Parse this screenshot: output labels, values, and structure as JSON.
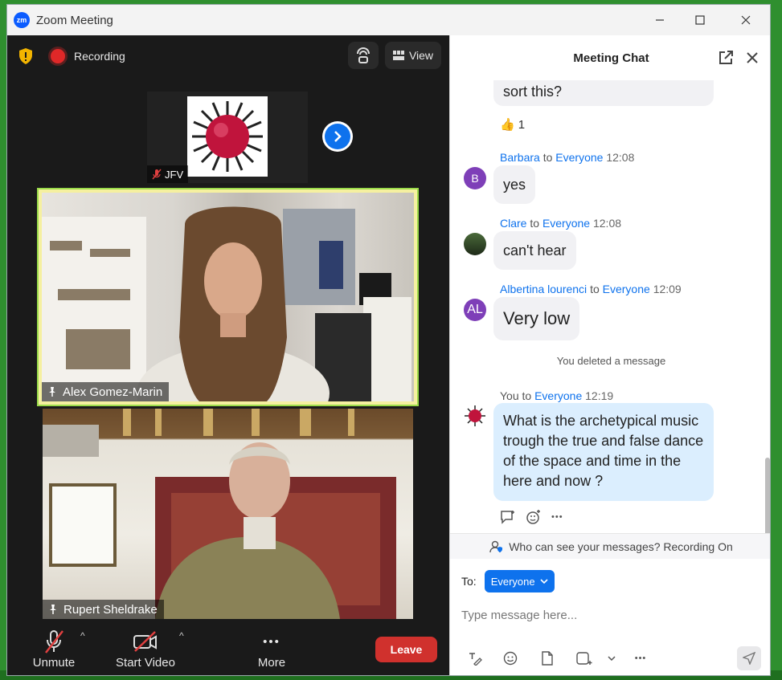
{
  "window": {
    "title": "Zoom Meeting",
    "logo": "zm"
  },
  "meeting": {
    "recording_label": "Recording",
    "view_label": "View",
    "thumbnail_name": "JFV",
    "tiles": [
      {
        "name": "Alex Gomez-Marin"
      },
      {
        "name": "Rupert Sheldrake"
      }
    ],
    "controls": {
      "unmute": "Unmute",
      "start_video": "Start Video",
      "more": "More",
      "leave": "Leave",
      "more_glyph": "•••"
    }
  },
  "chat": {
    "title": "Meeting Chat",
    "messages": {
      "partial_text": "sort this?",
      "reaction_emoji": "👍",
      "reaction_count": "1",
      "m1": {
        "sender": "Barbara",
        "to": "to",
        "recipient": "Everyone",
        "time": "12:08",
        "avatar": "B",
        "text": "yes"
      },
      "m2": {
        "sender": "Clare",
        "to": "to",
        "recipient": "Everyone",
        "time": "12:08",
        "text": "can't hear"
      },
      "m3": {
        "sender": "Albertina lourenci",
        "to": "to",
        "recipient": "Everyone",
        "time": "12:09",
        "avatar": "AL",
        "text": "Very low"
      },
      "deleted": "You deleted a message",
      "m4": {
        "sender": "You",
        "to": "to",
        "recipient": "Everyone",
        "time": "12:19",
        "text": "What is the archetypical music trough the true and false dance of the space and time in the here and now  ?"
      }
    },
    "privacy_notice": "Who can see your messages? Recording On",
    "to_label": "To:",
    "to_value": "Everyone",
    "input_placeholder": "Type message here...",
    "more_glyph": "•••"
  },
  "colors": {
    "accent": "#0e72ed",
    "leave": "#d0312d",
    "avatar_purple": "#7e3fb8"
  }
}
